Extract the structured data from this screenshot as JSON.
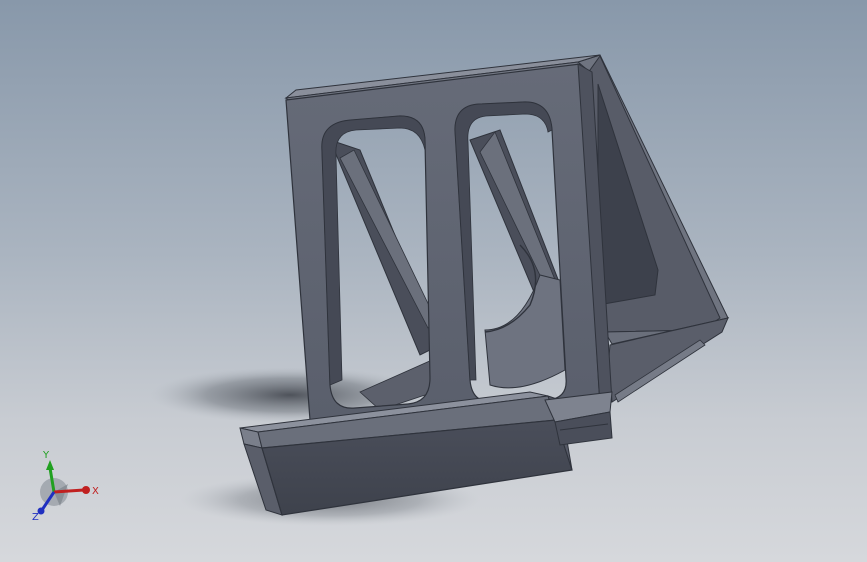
{
  "viewport": {
    "background_top": "#8898aa",
    "background_bottom": "#d6d8dc"
  },
  "model": {
    "part_color": "#5c6170",
    "face_dark": "#3f4350",
    "face_light": "#7a7f8c",
    "edge_color": "#2a2d36"
  },
  "triad": {
    "x_label": "X",
    "y_label": "Y",
    "z_label": "Z",
    "x_color": "#c02020",
    "y_color": "#20a020",
    "z_color": "#2030c0"
  }
}
